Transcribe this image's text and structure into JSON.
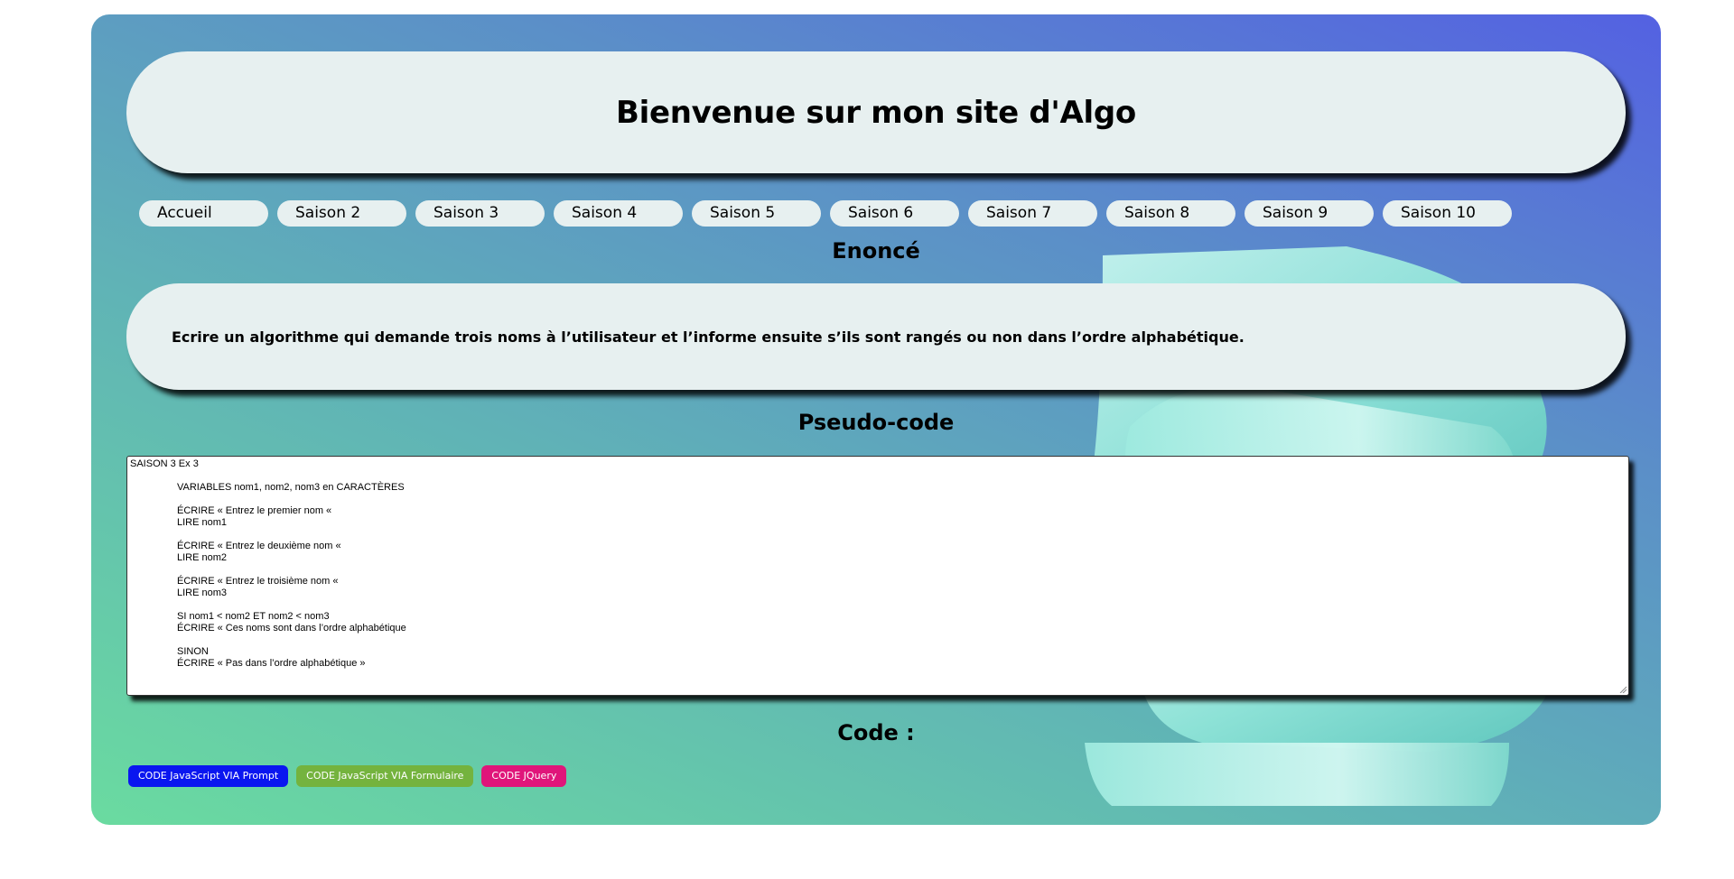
{
  "header": {
    "title": "Bienvenue sur mon site d'Algo"
  },
  "nav": {
    "items": [
      "Accueil",
      "Saison 2",
      "Saison 3",
      "Saison 4",
      "Saison 5",
      "Saison 6",
      "Saison 7",
      "Saison 8",
      "Saison 9",
      "Saison 10"
    ]
  },
  "enonce": {
    "heading": "Enoncé",
    "text": "Ecrire un algorithme qui demande trois noms à l’utilisateur et l’informe ensuite s’ils sont rangés ou non dans l’ordre alphabétique."
  },
  "pseudocode": {
    "heading": "Pseudo-code",
    "title_line": "SAISON 3 Ex 3",
    "lines": [
      "VARIABLES nom1, nom2, nom3 en CARACTÈRES",
      "",
      "ÉCRIRE « Entrez le premier nom «",
      "LIRE nom1",
      "",
      "ÉCRIRE « Entrez le deuxième nom «",
      "LIRE nom2",
      "",
      "ÉCRIRE « Entrez le troisième nom «",
      "LIRE nom3",
      "",
      "SI nom1 < nom2 ET nom2 < nom3",
      "ÉCRIRE « Ces noms sont dans l’ordre alphabétique",
      "",
      "SINON",
      "ÉCRIRE « Pas dans l’ordre alphabétique »"
    ]
  },
  "code": {
    "heading": "Code :",
    "buttons": [
      {
        "label": "CODE JavaScript VIA Prompt",
        "color": "#0a16f0"
      },
      {
        "label": "CODE JavaScript VIA Formulaire",
        "color": "#74b33e"
      },
      {
        "label": "CODE JQuery",
        "color": "#e0157a"
      }
    ]
  },
  "colors": {
    "gradient_start": "#6adba0",
    "gradient_end": "#5461e2",
    "panel": "#e7f0f0"
  }
}
